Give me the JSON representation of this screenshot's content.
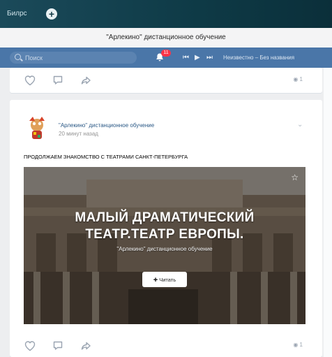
{
  "browser": {
    "tab_title": "Билрс",
    "new_tab_icon": "+"
  },
  "window_title": "\"Арлекино\" дистанционное обучение",
  "nav": {
    "search_placeholder": "Поиск",
    "notifications_badge": "11",
    "player_controls": [
      "⏮",
      "▶",
      "⏭"
    ],
    "now_playing": "Неизвестно – Без названия",
    "accent": "#4a76a8"
  },
  "post_prev": {
    "views": "1"
  },
  "post": {
    "author": "\"Арлекино\" дистанционное обучение",
    "time": "20 минут назад",
    "text": "ПРОДОЛЖАЕМ ЗНАКОМСТВО С ТЕАТРАМИ САНКТ-ПЕТЕРБУРГА",
    "banner": {
      "title_line1": "МАЛЫЙ ДРАМАТИЧЕСКИЙ",
      "title_line2": "ТЕАТР.ТЕАТР ЕВРОПЫ.",
      "subtitle": "\"Арлекино\" дистанционное обучение",
      "read_button": "Читать"
    },
    "views": "1"
  }
}
